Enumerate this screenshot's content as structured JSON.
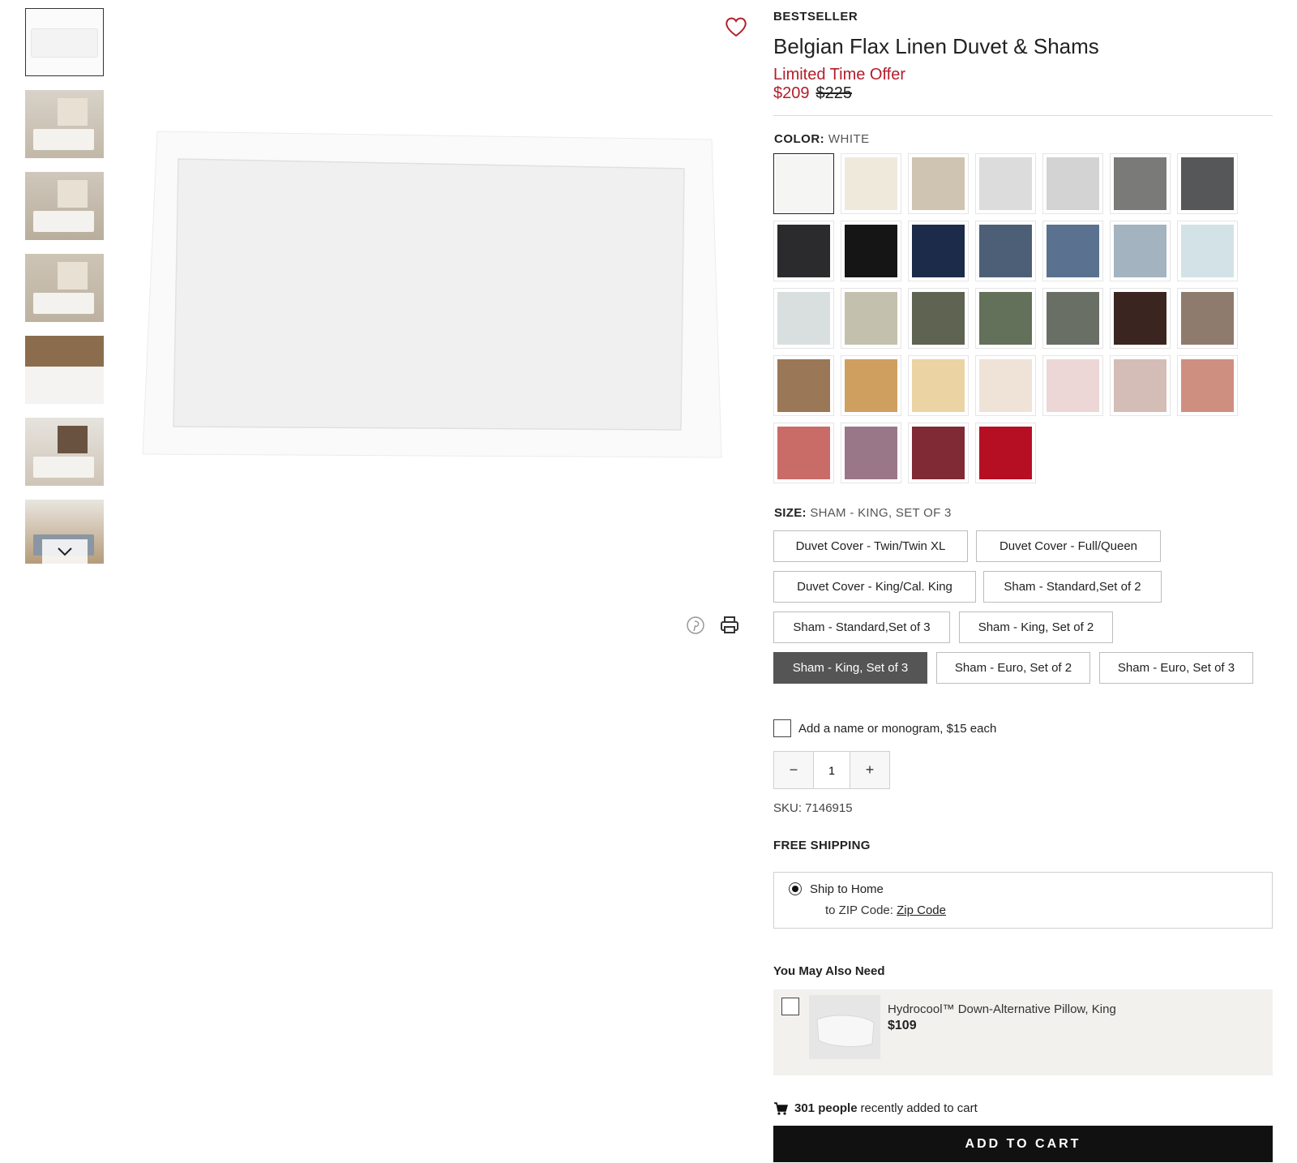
{
  "product": {
    "badge": "BESTSELLER",
    "title": "Belgian Flax Linen Duvet & Shams",
    "offer_text": "Limited Time Offer",
    "price_now": "$209",
    "price_was": "$225"
  },
  "color": {
    "label": "COLOR:",
    "value": "WHITE",
    "swatches": [
      "#f5f5f4",
      "#efe9dc",
      "#cfc3b1",
      "#dcdcdc",
      "#d3d3d3",
      "#7a7a78",
      "#565758",
      "#2b2b2d",
      "#151516",
      "#1c2b4a",
      "#4d5f77",
      "#5a7290",
      "#a3b3c0",
      "#d2e2e7",
      "#d9dfdf",
      "#c3c0ad",
      "#5e6352",
      "#63705a",
      "#6a6f66",
      "#3b2521",
      "#8e7b6d",
      "#9a7756",
      "#cf9f5f",
      "#ebd3a3",
      "#eee3d6",
      "#ecd6d6",
      "#d4bdb7",
      "#cf8f80",
      "#c96b67",
      "#9a7689",
      "#7f2a34",
      "#b60f23"
    ]
  },
  "size": {
    "label": "SIZE:",
    "value": "SHAM - KING, SET OF 3",
    "options": [
      "Duvet Cover - Twin/Twin XL",
      "Duvet Cover - Full/Queen",
      "Duvet Cover - King/Cal. King",
      "Sham - Standard,Set of 2",
      "Sham - Standard,Set of 3",
      "Sham - King, Set of 2",
      "Sham - King, Set of 3",
      "Sham - Euro, Set of 2",
      "Sham - Euro, Set of 3"
    ]
  },
  "monogram_label": "Add a name or monogram, $15 each",
  "quantity": {
    "minus": "−",
    "value": "1",
    "plus": "+"
  },
  "sku": "SKU: 7146915",
  "shipping": {
    "heading": "FREE SHIPPING",
    "option": "Ship to Home",
    "zip_prefix": "to ZIP Code:",
    "zip_link": "Zip Code"
  },
  "also_need": {
    "heading": "You May Also Need",
    "item_name": "Hydrocool™ Down-Alternative Pillow, King",
    "item_price": "$109"
  },
  "recent": {
    "count": "301 people",
    "text": "recently added to cart"
  },
  "cta_label": "ADD TO CART",
  "icons": [
    "heart-icon",
    "pinterest-icon",
    "print-icon",
    "chevron-down-icon",
    "cart-icon"
  ],
  "accent_color": "#b31d2a"
}
